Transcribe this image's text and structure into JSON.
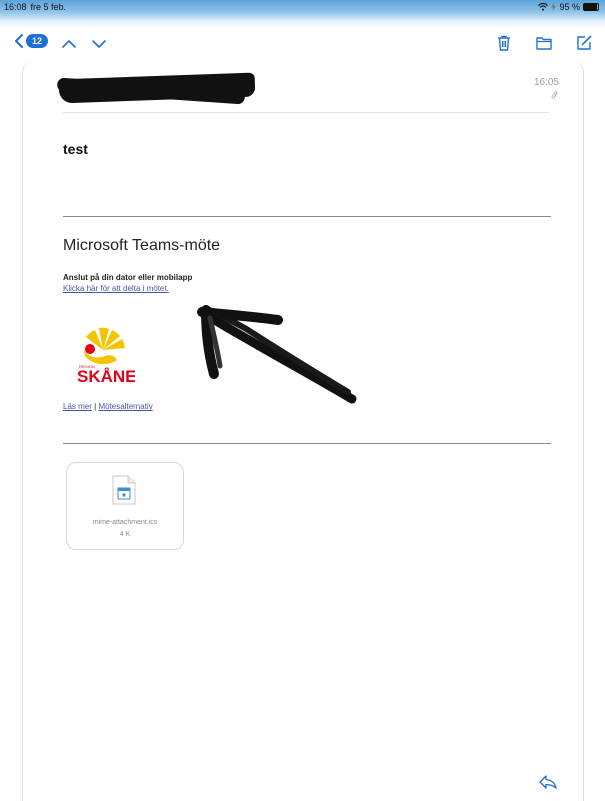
{
  "status_bar": {
    "time": "16:08",
    "date": "fre 5 feb.",
    "battery": "95 %",
    "battery_level": 0.95
  },
  "toolbar": {
    "unread_count": "12",
    "icons": [
      "chevron-left-icon",
      "chevron-up-icon",
      "chevron-down-icon",
      "trash-icon",
      "folder-icon",
      "compose-icon"
    ]
  },
  "email": {
    "time": "16:05",
    "subject": "test",
    "teams_title": "Microsoft Teams-möte",
    "join_heading": "Anslut på din dator eller mobilapp",
    "join_link": "Klicka här för att delta i mötet.",
    "logo_text": "SKÅNE",
    "logo_small_text": "REGION",
    "learn_more": "Läs mer",
    "separator": "|",
    "meeting_options": "Mötesalternativ",
    "attachment": {
      "name": "mime-attachment.ics",
      "size": "4 K"
    }
  },
  "colors": {
    "accent": "#1f6fd6",
    "link": "#4a55a8",
    "logo_red": "#e3001b",
    "logo_yellow": "#f5c400"
  }
}
